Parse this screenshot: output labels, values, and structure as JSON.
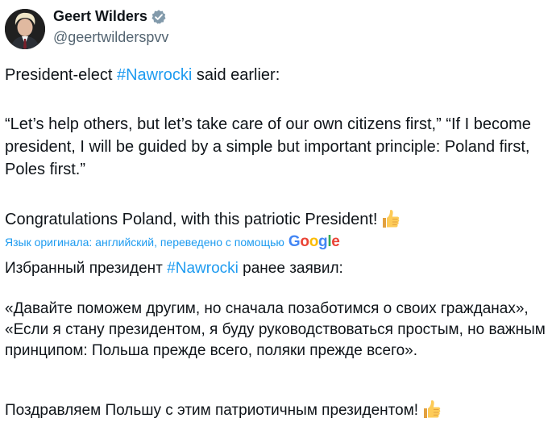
{
  "author": {
    "display_name": "Geert Wilders",
    "handle": "@geertwilderspvv",
    "verified": true,
    "avatar_icon": "profile-photo-icon",
    "verified_icon": "verified-badge-icon"
  },
  "tweet": {
    "p1": {
      "before": "President-elect ",
      "hashtag": "#Nawrocki",
      "after": " said earlier:"
    },
    "p2": "“Let’s help others, but let’s take care of our own citizens first,” “If I become president, I will be guided by a simple but important principle: Poland first, Poles first.”",
    "p3": "Congratulations Poland, with this patriotic President!",
    "emoji_icon": "thumbs-up-emoji-icon"
  },
  "translation": {
    "notice": "Язык оригинала: английский, переведено с помощью",
    "provider": "Google",
    "provider_colors": [
      "#4285f4",
      "#ea4335",
      "#fbbc05",
      "#4285f4",
      "#34a853",
      "#ea4335"
    ]
  },
  "translated": {
    "p1": {
      "before": "Избранный президент ",
      "hashtag": "#Nawrocki",
      "after": " ранее заявил:"
    },
    "p2": "«Давайте поможем другим, но сначала позаботимся о своих гражданах», «Если я стану президентом, я буду руководствоваться простым, но важным принципом: Польша прежде всего, поляки прежде всего».",
    "p3": "Поздравляем Польшу с этим патриотичным президентом!"
  },
  "colors": {
    "text": "#0f1419",
    "secondary": "#536471",
    "link": "#1d9bf0"
  }
}
